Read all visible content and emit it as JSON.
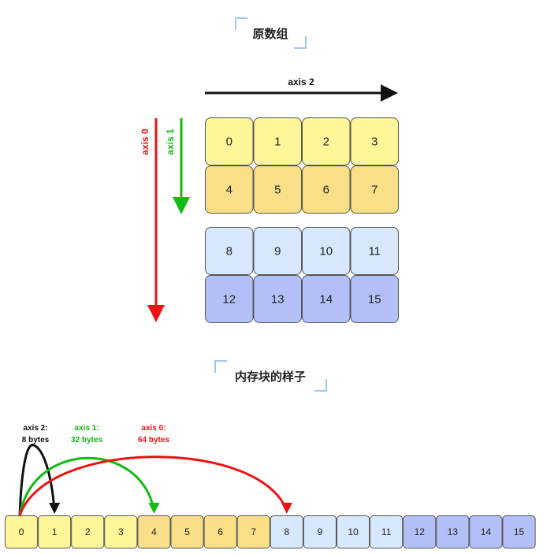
{
  "titles": {
    "original_array": "原数组",
    "memory_layout": "内存块的样子"
  },
  "axes": {
    "axis0": "axis 0",
    "axis1": "axis 1",
    "axis2": "axis 2"
  },
  "colors": {
    "axis0": "#ee1111",
    "axis1": "#11bb11",
    "axis2": "#111111",
    "yellow_light": "#fff599",
    "yellow_dark": "#f9df87",
    "blue_light": "#d7e8fd",
    "blue_dark": "#b2c0f7",
    "border": "#555555",
    "title_bracket": "#9ec7f0"
  },
  "grid": {
    "rows": [
      {
        "values": [
          "0",
          "1",
          "2",
          "3"
        ],
        "color": "yellow_light"
      },
      {
        "values": [
          "4",
          "5",
          "6",
          "7"
        ],
        "color": "yellow_dark"
      },
      {
        "values": [
          "8",
          "9",
          "10",
          "11"
        ],
        "color": "blue_light"
      },
      {
        "values": [
          "12",
          "13",
          "14",
          "15"
        ],
        "color": "blue_dark"
      }
    ]
  },
  "memory": {
    "cells": [
      "0",
      "1",
      "2",
      "3",
      "4",
      "5",
      "6",
      "7",
      "8",
      "9",
      "10",
      "11",
      "12",
      "13",
      "14",
      "15"
    ],
    "cell_colors": [
      "yellow_light",
      "yellow_light",
      "yellow_light",
      "yellow_light",
      "yellow_dark",
      "yellow_dark",
      "yellow_dark",
      "yellow_dark",
      "blue_light",
      "blue_light",
      "blue_light",
      "blue_light",
      "blue_dark",
      "blue_dark",
      "blue_dark",
      "blue_dark"
    ],
    "strides": [
      {
        "axis": "axis 2:",
        "bytes": "8 bytes",
        "color": "axis2",
        "target_index": 1
      },
      {
        "axis": "axis 1:",
        "bytes": "32 bytes",
        "color": "axis1",
        "target_index": 4
      },
      {
        "axis": "axis 0:",
        "bytes": "64 bytes",
        "color": "axis0",
        "target_index": 8
      }
    ]
  }
}
